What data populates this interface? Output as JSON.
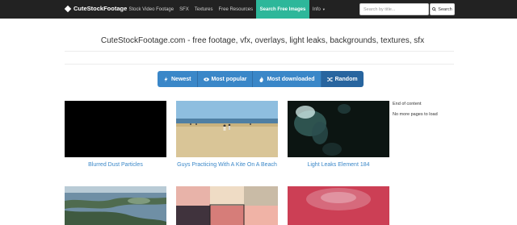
{
  "navbar": {
    "brand": "CuteStockFootage",
    "links": [
      "Stock Video Footage",
      "SFX",
      "Textures",
      "Free Resources",
      "Search Free Images",
      "Info"
    ],
    "active_link": "Search Free Images",
    "search_placeholder": "Search by title...",
    "search_button": "Search"
  },
  "page": {
    "title": "CuteStockFootage.com - free footage, vfx, overlays, light leaks, backgrounds, textures, sfx"
  },
  "sort_buttons": {
    "newest": "Newest",
    "most_popular": "Most popular",
    "most_downloaded": "Most downloaded",
    "random": "Random",
    "active": "Random"
  },
  "items": [
    {
      "title": "Blurred Dust Particles"
    },
    {
      "title": "Guys Practicing With A Kite On A Beach"
    },
    {
      "title": "Light Leaks Element 184"
    }
  ],
  "sidebar": {
    "end_text": "End of content",
    "no_more_text": "No more pages to load"
  },
  "colors": {
    "navbar_bg": "#222222",
    "active_tab": "#2db79a",
    "button_blue": "#3a87c8",
    "link_blue": "#3a87c8"
  }
}
